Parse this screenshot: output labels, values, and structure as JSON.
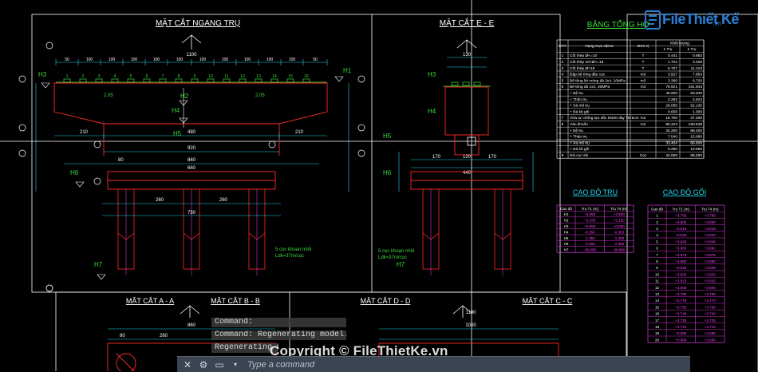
{
  "drawing": {
    "titles": {
      "ngang_tru": "MẶT CẮT NGANG TRỤ",
      "e_e": "MẶT CẮT E - E",
      "bang": "BẢNG TỔNG HỢ",
      "a_a": "MẶT CẮT A - A",
      "b_b": "MẶT CẮT B - B",
      "d_d": "MẶT CẮT D - D",
      "c_c": "MẶT CẮT C - C",
      "cao_do_tru": "CAO ĐỘ TRỤ",
      "cao_do_goi": "CAO ĐỘ GỐI"
    },
    "labels": {
      "h1": "H1",
      "h2": "H2",
      "h3": "H3",
      "h4": "H4",
      "h5": "H5",
      "h6": "H6",
      "h7": "H7",
      "coc_left_1": "5 cọc khoan nhồi",
      "coc_left_2": "Ldk=37m/cọc",
      "coc_right_1": "5 cọc khoan nhồi",
      "coc_right_2": "Ldk=37m/cọc",
      "dim_1100": "1100",
      "dim_940": "940",
      "dim_920": "920",
      "dim_860": "860",
      "dim_750": "750",
      "dim_660": "660",
      "dim_130": "130",
      "dim_170": "170",
      "dim_80": "80",
      "dim_210": "210",
      "dim_160": "160",
      "dim_260": "260",
      "dim_1190": "1190",
      "dim_1000": "1000",
      "dim_480": "480",
      "dim_120": "120",
      "dim_440": "440",
      "level_205": "2.05",
      "level_110": "1.10",
      "dim_100": "100",
      "dim_150": "150",
      "dim_640": "640",
      "dim_50": "50"
    },
    "table": {
      "col_stt": "STT",
      "col_name": "Hạng mục vật tư",
      "col_unit": "Đơn vị",
      "col_kl": "Khối lượng",
      "col_1tru": "1 Trụ",
      "col_2tru": "2 Trụ",
      "rows": [
        {
          "stt": "1",
          "name": "Cốt thép Ø<=10",
          "unit": "T",
          "v1": "0.441",
          "v2": "0.882"
        },
        {
          "stt": "2",
          "name": "Cốt thép 10<Ø<=18",
          "unit": "T",
          "v1": "1.704",
          "v2": "3.408"
        },
        {
          "stt": "3",
          "name": "Cốt thép Ø>18",
          "unit": "T",
          "v1": "5.707",
          "v2": "11.413"
        },
        {
          "stt": "4",
          "name": "Đập bê tông đầu cọc",
          "unit": "m3",
          "v1": "3.927",
          "v2": "7.854"
        },
        {
          "stt": "5",
          "name": "Bê tông lót móng đá 2x4, 10MPa",
          "unit": "m3",
          "v1": "3.360",
          "v2": "6.720"
        },
        {
          "stt": "6",
          "name": "Bê tông đá 1x2, 30MPa",
          "unit": "m3",
          "v1": "75.921",
          "v2": "151.843"
        },
        {
          "stt": "",
          "name": "+ Bệ trụ",
          "unit": "",
          "v1": "46.920",
          "v2": "93.840"
        },
        {
          "stt": "",
          "name": "+ Thân trụ",
          "unit": "",
          "v1": "2.262",
          "v2": "4.524"
        },
        {
          "stt": "",
          "name": "+ Xà mũ trụ",
          "unit": "",
          "v1": "26.065",
          "v2": "52.130"
        },
        {
          "stt": "",
          "name": "+ Đá kê gối",
          "unit": "",
          "v1": "0.655",
          "v2": "1.309"
        },
        {
          "stt": "7",
          "name": "Vữa tự chống tạo dốc M100 dày TB 5cm",
          "unit": "m2",
          "v1": "18.700",
          "v2": "37.400"
        },
        {
          "stt": "8",
          "name": "Ván khuôn",
          "unit": "m2",
          "v1": "80.424",
          "v2": "160.848"
        },
        {
          "stt": "",
          "name": "+ Bệ trụ",
          "unit": "",
          "v1": "34.200",
          "v2": "68.400"
        },
        {
          "stt": "",
          "name": "+ Thân trụ",
          "unit": "",
          "v1": "7.540",
          "v2": "15.080"
        },
        {
          "stt": "",
          "name": "+ Xà mũ trụ",
          "unit": "",
          "v1": "33.404",
          "v2": "66.808"
        },
        {
          "stt": "",
          "name": "+ Đá kê gối",
          "unit": "",
          "v1": "5.280",
          "v2": "10.560"
        },
        {
          "stt": "9",
          "name": "Sỏi cọc sỏi",
          "unit": "Cọc",
          "v1": "44.000",
          "v2": "88.000"
        }
      ]
    },
    "cao_do_tru_table": {
      "headers": [
        "Cao độ",
        "Trụ T1 (m)",
        "Trụ T4 (m)"
      ],
      "rows": [
        [
          "H1",
          "+3.850",
          "+3.850"
        ],
        [
          "H2",
          "+2.150",
          "+2.150"
        ],
        [
          "H3",
          "+0.850",
          "+0.850"
        ],
        [
          "H4",
          "-0.350",
          "-0.350"
        ],
        [
          "H5",
          "-1.350",
          "-1.350"
        ],
        [
          "H6",
          "-2.850",
          "-2.850"
        ],
        [
          "H7",
          "-39.850",
          "-39.850"
        ]
      ]
    },
    "cao_do_goi_table": {
      "headers": [
        "Cao độ",
        "Trụ T1 (m)",
        "Trụ T4 (m)"
      ],
      "rows": [
        [
          "1",
          "+3.785",
          "+3.785"
        ],
        [
          "2",
          "+3.800",
          "+3.800"
        ],
        [
          "3",
          "+3.815",
          "+3.815"
        ],
        [
          "4",
          "+3.830",
          "+3.830"
        ],
        [
          "5",
          "+3.845",
          "+3.845"
        ],
        [
          "6",
          "+3.860",
          "+3.860"
        ],
        [
          "7",
          "+3.875",
          "+3.875"
        ],
        [
          "8",
          "+3.860",
          "+3.860"
        ],
        [
          "9",
          "+3.845",
          "+3.845"
        ],
        [
          "10",
          "+3.830",
          "+3.830"
        ],
        [
          "11",
          "+3.815",
          "+3.815"
        ],
        [
          "12",
          "+3.800",
          "+3.800"
        ],
        [
          "13",
          "+3.785",
          "+3.785"
        ],
        [
          "14",
          "+3.770",
          "+3.770"
        ],
        [
          "15",
          "+3.755",
          "+3.755"
        ],
        [
          "16",
          "+3.740",
          "+3.740"
        ],
        [
          "17",
          "+3.725",
          "+3.725"
        ],
        [
          "18",
          "+3.710",
          "+3.710"
        ],
        [
          "19",
          "+3.695",
          "+3.695"
        ],
        [
          "20",
          "+3.680",
          "+3.680"
        ]
      ]
    }
  },
  "command_history": [
    "Command:",
    "Command: Regenerating model.",
    "Regenerating mo"
  ],
  "command_line": {
    "placeholder": "Type a command"
  },
  "watermark": "Copyright © FileThietKe.vn",
  "logo": {
    "text_1": "File",
    "text_2": "Thiết Kế",
    "text_3": ".vn"
  },
  "colors": {
    "red": "#ff2a2a",
    "green": "#3cdc3c",
    "yellow": "#ffff00",
    "cyan": "#22d3ee",
    "magenta": "#ff40ff",
    "white": "#ffffff"
  }
}
